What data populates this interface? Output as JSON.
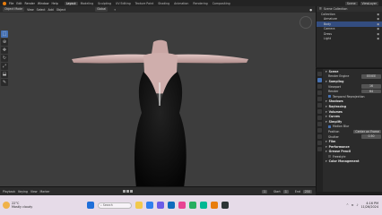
{
  "topbar": {
    "menus": [
      "File",
      "Edit",
      "Render",
      "Window",
      "Help"
    ],
    "workspaces": [
      "Layout",
      "Modeling",
      "Sculpting",
      "UV Editing",
      "Texture Paint",
      "Shading",
      "Animation",
      "Rendering",
      "Compositing"
    ],
    "active_workspace": "Layout",
    "scene": "Scene",
    "view_layer": "ViewLayer"
  },
  "viewport_header": {
    "mode": "Object Mode",
    "menus": [
      "View",
      "Select",
      "Add",
      "Object"
    ],
    "transform": "Global"
  },
  "outliner": {
    "title": "Scene Collection",
    "rows": [
      {
        "label": "Collection",
        "indent": 1,
        "selected": false
      },
      {
        "label": "Armature",
        "indent": 2,
        "selected": false
      },
      {
        "label": "Body",
        "indent": 2,
        "selected": true
      },
      {
        "label": "Camera",
        "indent": 2,
        "selected": false
      },
      {
        "label": "Dress",
        "indent": 2,
        "selected": false
      },
      {
        "label": "Light",
        "indent": 2,
        "selected": false
      }
    ]
  },
  "properties": {
    "rows": [
      {
        "label": "Scene",
        "type": "section"
      },
      {
        "label": "Render Engine",
        "value": "EEVEE",
        "type": "field"
      },
      {
        "label": "Sampling",
        "type": "section"
      },
      {
        "label": "Viewport",
        "value": "16",
        "type": "field"
      },
      {
        "label": "Render",
        "value": "64",
        "type": "field"
      },
      {
        "label": "Temporal Reprojection",
        "type": "check",
        "on": true
      },
      {
        "label": "Shadows",
        "type": "section"
      },
      {
        "label": "Raytracing",
        "type": "section"
      },
      {
        "label": "Volumes",
        "type": "section"
      },
      {
        "label": "Curves",
        "type": "section"
      },
      {
        "label": "Simplify",
        "type": "section"
      },
      {
        "label": "Motion Blur",
        "type": "check",
        "on": true
      },
      {
        "label": "Position",
        "value": "Center on Frame",
        "type": "field"
      },
      {
        "label": "Shutter",
        "value": "0.50",
        "type": "field"
      },
      {
        "label": "Film",
        "type": "section"
      },
      {
        "label": "Performance",
        "type": "section"
      },
      {
        "label": "Grease Pencil",
        "type": "section"
      },
      {
        "label": "Freestyle",
        "type": "check",
        "on": false
      },
      {
        "label": "Color Management",
        "type": "section"
      }
    ]
  },
  "timeline": {
    "menus": [
      "Playback",
      "Keying",
      "View",
      "Marker"
    ],
    "current_frame": "1",
    "start": "1",
    "end": "250"
  },
  "taskbar": {
    "weather_temp": "22°C",
    "weather_desc": "Mostly cloudy",
    "search_placeholder": "Search",
    "time": "4:16 PM",
    "date": "11/26/2024",
    "apps": [
      {
        "name": "file-explorer-icon",
        "color": "#f2c94c"
      },
      {
        "name": "browser-icon",
        "color": "#2f80ed"
      },
      {
        "name": "store-icon",
        "color": "#6c5ce7"
      },
      {
        "name": "mail-icon",
        "color": "#0f6cbd"
      },
      {
        "name": "media-icon",
        "color": "#e84393"
      },
      {
        "name": "chat-icon",
        "color": "#27ae60"
      },
      {
        "name": "photos-icon",
        "color": "#00b894"
      },
      {
        "name": "blender-icon",
        "color": "#e87d0d"
      },
      {
        "name": "terminal-icon",
        "color": "#2d3436"
      }
    ]
  },
  "colors": {
    "accent": "#4772b3",
    "viewport_bg": "#3d3d3d",
    "skin": "#d7b4b2",
    "dress": "#0b0b0b"
  }
}
